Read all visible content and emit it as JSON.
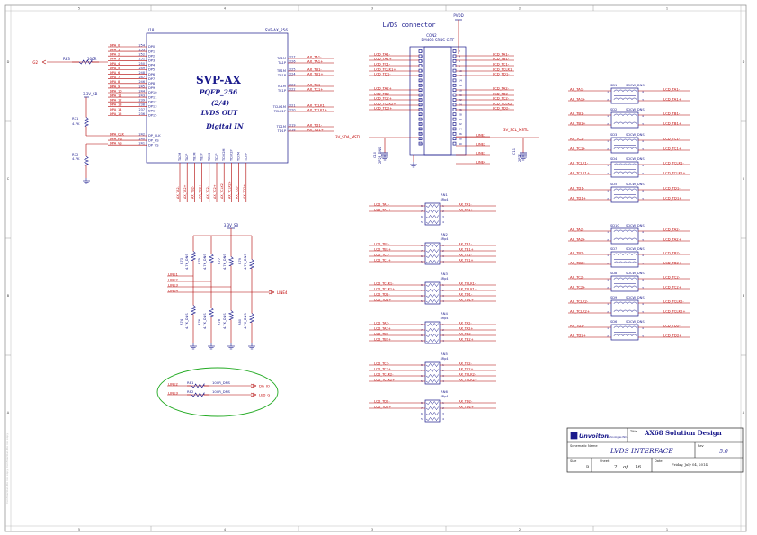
{
  "border": {
    "top_cols": [
      "5",
      "4",
      "3",
      "2",
      "1"
    ],
    "rows": [
      "D",
      "C",
      "B",
      "A"
    ]
  },
  "left_margin_note": "Confidential, Do not copy",
  "u18": {
    "ref": "U18",
    "part": "SVP-AX_256",
    "title": "SVP-AX",
    "sub1": "PQFP_256",
    "sub2": "(2/4)",
    "sub3": "LVDS OUT",
    "sub4": "Digital IN",
    "left_pins": [
      {
        "net": "DPA_0",
        "num": "254",
        "name": "DP0"
      },
      {
        "net": "DPA_1",
        "num": "253",
        "name": "DP1"
      },
      {
        "net": "DPA_2",
        "num": "252",
        "name": "DP2"
      },
      {
        "net": "DPA_3",
        "num": "251",
        "name": "DP3"
      },
      {
        "net": "DPA_4",
        "num": "250",
        "name": "DP4"
      },
      {
        "net": "DPA_5",
        "num": "249",
        "name": "DP5"
      },
      {
        "net": "DPA_6",
        "num": "248",
        "name": "DP6"
      },
      {
        "net": "DPA_7",
        "num": "247",
        "name": "DP7"
      },
      {
        "net": "DPA_8",
        "num": "246",
        "name": "DP8"
      },
      {
        "net": "DPA_9",
        "num": "245",
        "name": "DP9"
      },
      {
        "net": "DPA_10",
        "num": "244",
        "name": "DP10"
      },
      {
        "net": "DPA_11",
        "num": "243",
        "name": "DP11"
      },
      {
        "net": "DPA_12",
        "num": "239",
        "name": "DP12"
      },
      {
        "net": "DPA_13",
        "num": "238",
        "name": "DP13"
      },
      {
        "net": "DPA_14",
        "num": "237",
        "name": "DP14"
      },
      {
        "net": "DPA_15",
        "num": "236",
        "name": "DP15"
      }
    ],
    "left_pins2": [
      {
        "net": "DPA_CLK",
        "num": "242",
        "name": "DP_CLK"
      },
      {
        "net": "DPA_HS",
        "num": "240",
        "name": "DP_HS"
      },
      {
        "net": "DPA_VS",
        "num": "241",
        "name": "DP_VS"
      }
    ],
    "right_pins": [
      {
        "name": "TA1M",
        "num": "227",
        "net": "AX_TA1-"
      },
      {
        "name": "TA1P",
        "num": "226",
        "net": "AX_TA1+"
      },
      {
        "name": "TB1M",
        "num": "225",
        "net": "AX_TB1-"
      },
      {
        "name": "TB1P",
        "num": "224",
        "net": "AX_TB1+"
      },
      {
        "name": "TC1M",
        "num": "223",
        "net": "AX_TC1-"
      },
      {
        "name": "TC1P",
        "num": "222",
        "net": "AX_TC1+"
      },
      {
        "name": "TCLK1M",
        "num": "221",
        "net": "AX_TCLK1-"
      },
      {
        "name": "TCLK1P",
        "num": "220",
        "net": "AX_TCLK1+"
      },
      {
        "name": "TD1M",
        "num": "219",
        "net": "AX_TD1-"
      },
      {
        "name": "TD1P",
        "num": "218",
        "net": "AX_TD1+"
      }
    ],
    "bottom_pins": [
      "TA2M",
      "TA2P",
      "TB2M",
      "TB2P",
      "TC2M",
      "TC2P",
      "TCLK2M",
      "TCLK2P",
      "TD2M",
      "TD2P"
    ],
    "bottom_nets": [
      "AX_TA2-",
      "AX_TA2+",
      "AX_TB2-",
      "AX_TB2+",
      "AX_TC2-",
      "AX_TC2+",
      "AX_TCLK2-",
      "AX_TCLK2+",
      "AX_TD2-",
      "AX_TD2+"
    ]
  },
  "left_side": {
    "net_g2": "G2",
    "r83": "R83",
    "r83_val": "100R",
    "supply": "3.3V_SB",
    "r71": "R71",
    "r71_val": "4.7K",
    "r72": "R72",
    "r72_val": "4.7K"
  },
  "connector": {
    "title": "LVDS connector",
    "pvdd": "PVDD",
    "ref": "CON2",
    "part": "BM40B-SRDS-G-TF",
    "left_nets": [
      "LCD_TA1-",
      "LCD_TA1+",
      "LCD_TC1-",
      "LCD_TCLK1+",
      "LCD_TD1-",
      "LCD_TA2+",
      "LCD_TB2-",
      "LCD_TC2+",
      "LCD_TCLK2+",
      "LCD_TD2+"
    ],
    "right_nets": [
      "LCD_TA1-",
      "LCD_TB1-",
      "LCD_TC1-",
      "LCD_TCLK1",
      "LCD_TD1-",
      "LCD_TA2-",
      "LCD_TB2-",
      "LCD_TC2-",
      "LCD_TCLK2",
      "LCD_TD2-"
    ],
    "lines_right": [
      "LINE1",
      "LINE2",
      "LINE3",
      "LINE4"
    ],
    "sda": "3V_SDA_MSTL",
    "scl": "3V_SCL_MSTL",
    "c_left": "C10",
    "c_left_val": "2P2F_DNS",
    "c_right": "C11",
    "c_right_val": "2P2F"
  },
  "rn_blocks": [
    {
      "ref": "RN1",
      "part": "8Rp4",
      "left": [
        "LCD_TA1-",
        "LCD_TA1+"
      ],
      "right": [
        "AX_TA1-",
        "AX_TA1+"
      ]
    },
    {
      "ref": "RN2",
      "part": "8Rp4",
      "left": [
        "LCD_TB1-",
        "LCD_TB1+",
        "LCD_TC1-",
        "LCD_TC1+"
      ],
      "right": [
        "AX_TB1-",
        "AX_TB1+",
        "AX_TC1-",
        "AX_TC1+"
      ]
    },
    {
      "ref": "RN3",
      "part": "8Rp4",
      "left": [
        "LCD_TCLK1-",
        "LCD_TCLK1+",
        "LCD_TD1-",
        "LCD_TD1+"
      ],
      "right": [
        "AX_TCLK1-",
        "AX_TCLK1+",
        "AX_TD1-",
        "AX_TD1+"
      ]
    },
    {
      "ref": "RN4",
      "part": "8Rp4",
      "left": [
        "LCD_TA2-",
        "LCD_TA2+",
        "LCD_TB2-",
        "LCD_TB2+"
      ],
      "right": [
        "AX_TA2-",
        "AX_TA2+",
        "AX_TB2-",
        "AX_TB2+"
      ]
    },
    {
      "ref": "RN5",
      "part": "8Rp4",
      "left": [
        "LCD_TC2-",
        "LCD_TC2+",
        "LCD_TCLK2-",
        "LCD_TCLK2+"
      ],
      "right": [
        "AX_TC2-",
        "AX_TC2+",
        "AX_TCLK2-",
        "AX_TCLK2+"
      ]
    },
    {
      "ref": "RN6",
      "part": "8Rp4",
      "left": [
        "LCD_TD2-",
        "LCD_TD2+"
      ],
      "right": [
        "AX_TD2-",
        "AX_TD2+"
      ]
    }
  ],
  "common_mode": [
    {
      "ref": "SD1",
      "part": "SDCW_DNS",
      "l": [
        "AX_TA1-",
        "AX_TA1+"
      ],
      "r": [
        "LCD_TA1-",
        "LCD_TA1+"
      ]
    },
    {
      "ref": "SD2",
      "part": "SDCW_DNS",
      "l": [
        "AX_TB1-",
        "AX_TB1+"
      ],
      "r": [
        "LCD_TB1-",
        "LCD_TB1+"
      ]
    },
    {
      "ref": "SD3",
      "part": "SDCW_DNS",
      "l": [
        "AX_TC1-",
        "AX_TC1+"
      ],
      "r": [
        "LCD_TC1-",
        "LCD_TC1+"
      ]
    },
    {
      "ref": "SD4",
      "part": "SDCW_DNS",
      "l": [
        "AX_TCLK1-",
        "AX_TCLK1+"
      ],
      "r": [
        "LCD_TCLK1-",
        "LCD_TCLK1+"
      ]
    },
    {
      "ref": "SD5",
      "part": "SDCW_DNS",
      "l": [
        "AX_TD1-",
        "AX_TD1+"
      ],
      "r": [
        "LCD_TD1-",
        "LCD_TD1+"
      ]
    },
    {
      "ref": "SD10",
      "part": "SDCW_DNS",
      "l": [
        "AX_TA2-",
        "AX_TA2+"
      ],
      "r": [
        "LCD_TA2-",
        "LCD_TA2+"
      ]
    },
    {
      "ref": "SD7",
      "part": "SDCW_DNS",
      "l": [
        "AX_TB2-",
        "AX_TB2+"
      ],
      "r": [
        "LCD_TB2-",
        "LCD_TB2+"
      ]
    },
    {
      "ref": "SD8",
      "part": "SDCW_DNS",
      "l": [
        "AX_TC2-",
        "AX_TC2+"
      ],
      "r": [
        "LCD_TC2-",
        "LCD_TC2+"
      ]
    },
    {
      "ref": "SD9",
      "part": "SDCW_DNS",
      "l": [
        "AX_TCLK2-",
        "AX_TCLK2+"
      ],
      "r": [
        "LCD_TCLK2-",
        "LCD_TCLK2+"
      ]
    },
    {
      "ref": "SD6",
      "part": "SDCW_DNS",
      "l": [
        "AX_TD2-",
        "AX_TD2+"
      ],
      "r": [
        "LCD_TD2-",
        "LCD_TD2+"
      ]
    }
  ],
  "line_block": {
    "supply": "3.3V_SB",
    "top_res": [
      {
        "ref": "R73",
        "val": "4.7K_DNS"
      },
      {
        "ref": "R75",
        "val": "4.7K_DNS"
      },
      {
        "ref": "R77",
        "val": "4.7K_DNS"
      },
      {
        "ref": "R79",
        "val": "4.7K_DNS"
      }
    ],
    "bot_res": [
      {
        "ref": "R74",
        "val": "4.7K_DNS"
      },
      {
        "ref": "R76",
        "val": "4.7K_DNS"
      },
      {
        "ref": "R78",
        "val": "4.7K_DNS"
      },
      {
        "ref": "R80",
        "val": "4.7K_DNS"
      }
    ],
    "lines": [
      "LINE1",
      "LINE2",
      "LINE3",
      "LINE4"
    ],
    "out": "LINE4"
  },
  "ellipse_block": {
    "rows": [
      {
        "net": "LINE2",
        "ref": "R81",
        "val": "100R_DNS",
        "out": "DG_IO"
      },
      {
        "net": "LINE3",
        "ref": "R82",
        "val": "100R_DNS",
        "out": "LED_G"
      }
    ]
  },
  "title_block": {
    "logo": "Unvoiton",
    "logo_sub": "technologies INC.",
    "title_label": "Title",
    "title": "AX68 Solution Design",
    "schematic_label": "Schematic Name",
    "schematic": "LVDS INTERFACE",
    "rev_label": "Rev",
    "rev": "5.0",
    "size_label": "Size",
    "size": "B",
    "sheet_label": "Sheet",
    "sheet": "2",
    "of": "of",
    "sheets": "16",
    "date_label": "Date",
    "date": "Friday, July 04, 2014"
  },
  "colors": {
    "wire": "#b00000",
    "line": "#1a1a8c",
    "text": "#1a1a8c",
    "net": "#c00000",
    "ellipse": "#22aa22"
  }
}
